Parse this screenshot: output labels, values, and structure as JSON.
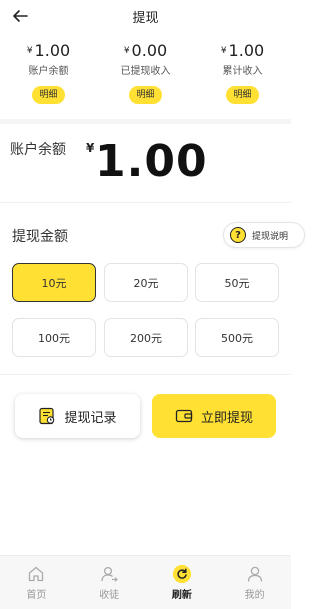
{
  "header": {
    "title": "提现"
  },
  "stats": [
    {
      "currency": "¥",
      "amount": "1.00",
      "label": "账户余额",
      "button": "明细"
    },
    {
      "currency": "¥",
      "amount": "0.00",
      "label": "已提现收入",
      "button": "明细"
    },
    {
      "currency": "¥",
      "amount": "1.00",
      "label": "累计收入",
      "button": "明细"
    }
  ],
  "balance": {
    "label": "账户余额",
    "currency": "¥",
    "value": "1.00"
  },
  "amount_section": {
    "label": "提现金额",
    "help": "提现说明",
    "help_icon": "?"
  },
  "options": [
    "10元",
    "20元",
    "50元",
    "100元",
    "200元",
    "500元"
  ],
  "selected_option_index": 0,
  "actions": {
    "record": "提现记录",
    "withdraw": "立即提现"
  },
  "tabbar": [
    {
      "label": "首页",
      "icon": "home-icon"
    },
    {
      "label": "收徒",
      "icon": "add-user-icon"
    },
    {
      "label": "刷新",
      "icon": "refresh-icon"
    },
    {
      "label": "我的",
      "icon": "profile-icon"
    }
  ],
  "active_tab_index": 2,
  "colors": {
    "accent": "#ffe033",
    "text": "#222222",
    "muted": "#999999"
  }
}
